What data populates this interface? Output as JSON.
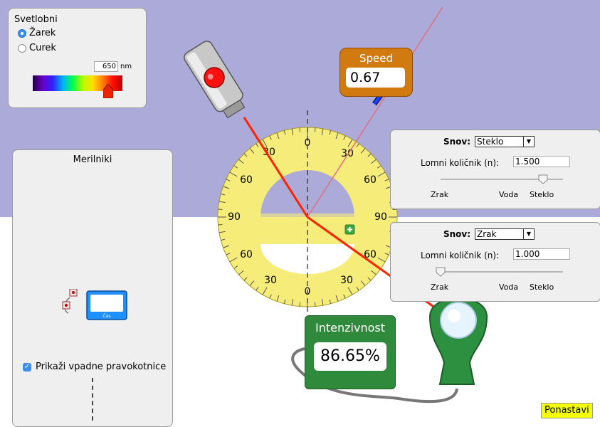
{
  "colors": {
    "top_medium": "#abaad8",
    "bottom_medium": "#ffffff",
    "beam": "#ff2200",
    "accent": "#3b8ff0"
  },
  "source": {
    "title": "Svetlobni",
    "options": [
      {
        "label": "Žarek",
        "selected": true
      },
      {
        "label": "Curek",
        "selected": false
      }
    ],
    "wavelength_value": "650",
    "wavelength_unit": "nm"
  },
  "protractor": {
    "upper_labels": [
      "0",
      "30",
      "30",
      "60",
      "60",
      "90",
      "90"
    ],
    "lower_labels": [
      "60",
      "60",
      "30",
      "30",
      "0"
    ]
  },
  "speed_meter": {
    "title": "Speed",
    "value": "0.67"
  },
  "tools": {
    "title": "Merilniki",
    "timer_label": "Čas",
    "normals_label": "Prikaži vpadne pravokotnice",
    "normals_checked": true
  },
  "top_medium": {
    "label": "Snov:",
    "selected": "Steklo",
    "n_label": "Lomni količnik (n):",
    "n_value": "1.500",
    "ticks": [
      "Zrak",
      "Voda",
      "Steklo"
    ],
    "slider_fraction": 1.0
  },
  "bottom_medium": {
    "label": "Snov:",
    "selected": "Zrak",
    "n_label": "Lomni količnik (n):",
    "n_value": "1.000",
    "ticks": [
      "Zrak",
      "Voda",
      "Steklo"
    ],
    "slider_fraction": 0.0
  },
  "intensity_meter": {
    "title": "Intenzivnost",
    "value": "86.65%"
  },
  "reset_label": "Ponastavi"
}
